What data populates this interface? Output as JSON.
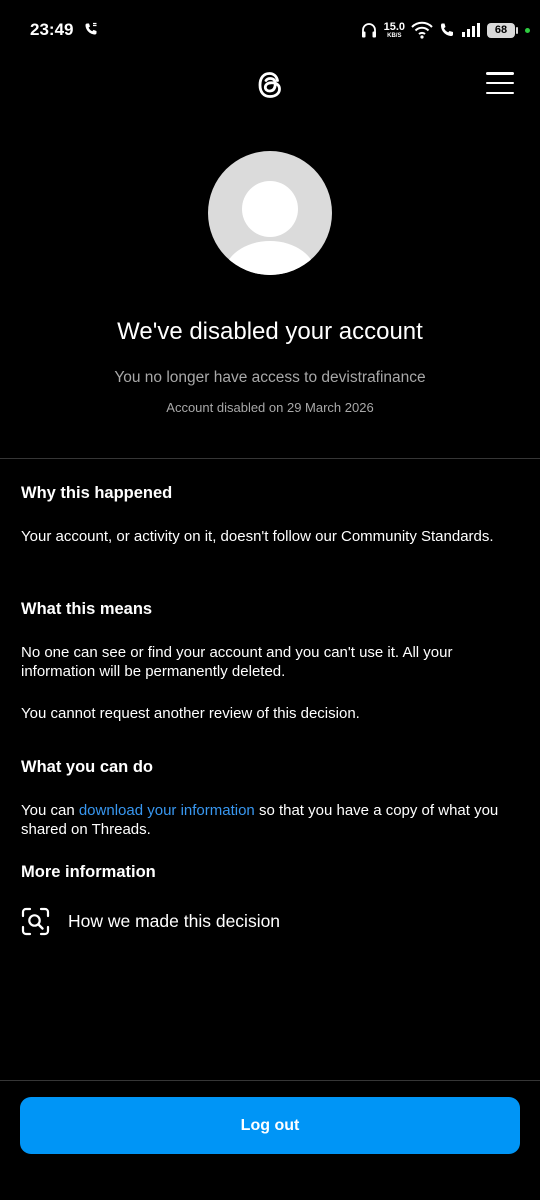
{
  "status_bar": {
    "time": "23:49",
    "net_speed_value": "15.0",
    "net_speed_unit": "KB/S",
    "battery": "68",
    "icons": [
      "wifi-call-icon",
      "headphones-icon",
      "wifi-icon",
      "volte-call-icon",
      "signal-icon",
      "battery-icon"
    ]
  },
  "header": {
    "logo_icon": "threads-logo-icon",
    "menu_icon": "hamburger-menu-icon"
  },
  "notice": {
    "title": "We've disabled your account",
    "subtitle": "You no longer have access to devistrafinance",
    "disabled_date": "Account disabled on 29 March 2026"
  },
  "sections": {
    "why": {
      "heading": "Why this happened",
      "body": "Your account, or activity on it, doesn't follow our Community Standards."
    },
    "means": {
      "heading": "What this means",
      "body1": "No one can see or find your account and you can't use it. All your information will be permanently deleted.",
      "body2": "You cannot request another review of this decision."
    },
    "can_do": {
      "heading": "What you can do",
      "prefix": "You can ",
      "link": "download your information",
      "suffix": " so that you have a copy of what you shared on Threads."
    },
    "more": {
      "heading": "More information",
      "item_label": "How we made this decision",
      "item_icon": "search-scan-icon"
    }
  },
  "footer": {
    "logout_label": "Log out"
  },
  "colors": {
    "background": "#000000",
    "accent": "#0095f6",
    "link": "#3897f0",
    "muted_text": "#a8a8a8",
    "avatar_bg": "#dbdbdb"
  }
}
